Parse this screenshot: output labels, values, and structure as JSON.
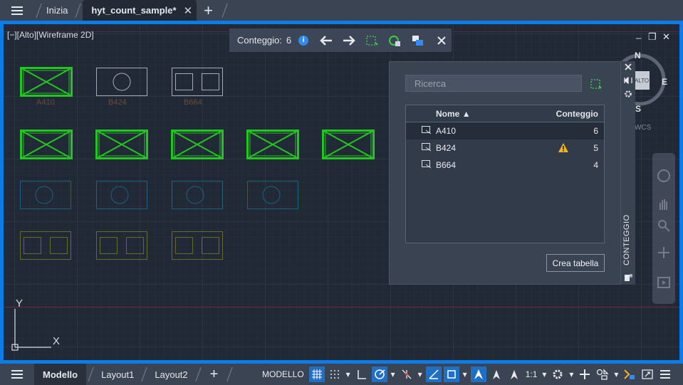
{
  "tabs": {
    "menu_icon": "hamburger-icon",
    "items": [
      {
        "label": "Inizia"
      },
      {
        "label": "hyt_count_sample*",
        "active": true
      }
    ],
    "close": "✕",
    "new": "+"
  },
  "viewport": {
    "label": "[−][Alto][Wireframe 2D]",
    "window_controls": [
      "_",
      "❐",
      "✕"
    ]
  },
  "blocks": {
    "row1_labels": [
      "A410",
      "B424",
      "B664"
    ]
  },
  "count_toolbar": {
    "label": "Conteggio:",
    "value": "6"
  },
  "viewcube": {
    "north": "N",
    "south": "S",
    "east": "E",
    "face": "ALTO",
    "wcs": "WCS"
  },
  "palette": {
    "search_placeholder": "Ricerca",
    "columns": {
      "name": "Nome",
      "count": "Conteggio"
    },
    "rows": [
      {
        "name": "A410",
        "count": "6",
        "warning": false
      },
      {
        "name": "B424",
        "count": "5",
        "warning": true
      },
      {
        "name": "B664",
        "count": "4",
        "warning": false
      }
    ],
    "create_table": "Crea tabella",
    "side_title": "CONTEGGIO"
  },
  "ucs": {
    "y": "Y",
    "x": "X"
  },
  "statusbar": {
    "tabs": [
      "Modello",
      "Layout1",
      "Layout2"
    ],
    "new": "+",
    "mode": "MODELLO",
    "scale": "1:1"
  },
  "colors": {
    "accent": "#0e7ce6",
    "selected_block": "#22c61f",
    "block_gray": "#a7aab0",
    "block_cyan": "#1f5f80",
    "block_yellow": "#6b6a25"
  }
}
